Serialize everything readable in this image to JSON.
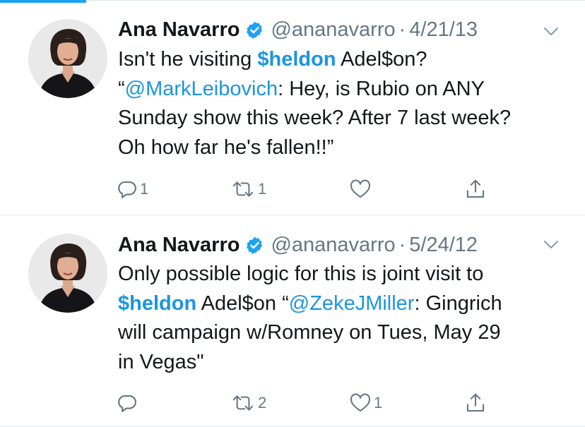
{
  "colors": {
    "accent": "#1da1f2",
    "link": "#1b95e0",
    "secondary": "#657786",
    "text": "#14171a",
    "divider": "#dfe5ea"
  },
  "tweets": [
    {
      "author": {
        "name": "Ana Navarro",
        "handle": "@ananavarro",
        "verified": true
      },
      "separator": "·",
      "date": "4/21/13",
      "text": {
        "l1a": "Isn't he visiting ",
        "l1b": "$heldon",
        "l1c": " Adel$on?",
        "l2a": "“",
        "l2b": "@MarkLeibovich",
        "l2c": ": Hey, is Rubio on ANY",
        "l3": "Sunday show this week? After 7 last week?",
        "l4": "Oh how far he's fallen!!”"
      },
      "actions": {
        "reply_count": "1",
        "retweet_count": "1",
        "like_count": ""
      },
      "icons": [
        "reply-icon",
        "retweet-icon",
        "heart-icon",
        "share-icon",
        "chevron-down-icon",
        "verified-badge-icon"
      ]
    },
    {
      "author": {
        "name": "Ana Navarro",
        "handle": "@ananavarro",
        "verified": true
      },
      "separator": "·",
      "date": "5/24/12",
      "text": {
        "l1": "Only possible logic for this is joint visit to",
        "l2a": "$heldon",
        "l2b": " Adel$on “",
        "l2c": "@ZekeJMiller",
        "l2d": ": Gingrich",
        "l3": "will campaign w/Romney on Tues, May 29",
        "l4": "in Vegas\""
      },
      "actions": {
        "reply_count": "",
        "retweet_count": "2",
        "like_count": "1"
      },
      "icons": [
        "reply-icon",
        "retweet-icon",
        "heart-icon",
        "share-icon",
        "chevron-down-icon",
        "verified-badge-icon"
      ]
    }
  ]
}
